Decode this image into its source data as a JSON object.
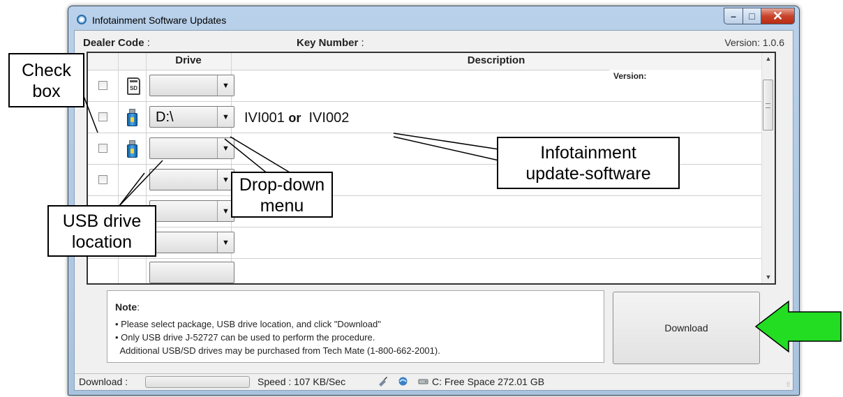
{
  "window": {
    "title": "Infotainment Software Updates",
    "minimize_glyph": "–",
    "maximize_glyph": "□",
    "close_glyph": "✕"
  },
  "header": {
    "dealer_label": "Dealer Code",
    "dealer_suffix": " :",
    "key_label": "Key Number",
    "key_suffix": " :",
    "version": "Version: 1.0.6"
  },
  "grid": {
    "columns": {
      "drive": "Drive",
      "description": "Description"
    },
    "version_label": "Version:",
    "dropdown_glyph": "▼",
    "rows": [
      {
        "icon": "sd-card-icon",
        "drive": "",
        "description": ""
      },
      {
        "icon": "usb-drive-icon",
        "drive": "D:\\",
        "desc_a": "IVI001 ",
        "desc_or": "or",
        "desc_b": "  IVI002"
      },
      {
        "icon": "usb-drive-icon",
        "drive": "",
        "description": ""
      },
      {
        "icon": "none",
        "drive": "",
        "description": ""
      },
      {
        "icon": "none",
        "drive": "",
        "description": ""
      },
      {
        "icon": "usb-drive-icon",
        "drive": "",
        "description": ""
      }
    ]
  },
  "note": {
    "title": "Note",
    "title_suffix": ":",
    "lines": [
      "• Please select package, USB drive location, and click \"Download\"",
      "• Only USB drive J-52727 can be used to perform the procedure.",
      "  Additional USB/SD drives may be purchased from Tech Mate (1-800-662-2001)."
    ]
  },
  "download_button": "Download",
  "status": {
    "download_label": "Download :",
    "speed": "Speed : 107 KB/Sec",
    "free_space": "C: Free Space 272.01 GB"
  },
  "callouts": {
    "check_box": [
      "Check",
      "box"
    ],
    "usb_location": [
      "USB drive",
      "location"
    ],
    "dropdown_menu": [
      "Drop-down",
      "menu"
    ],
    "infotainment": [
      "Infotainment",
      "update-software"
    ]
  },
  "colors": {
    "arrow_fill": "#22dd22",
    "window_frame": "#a9c3df"
  }
}
